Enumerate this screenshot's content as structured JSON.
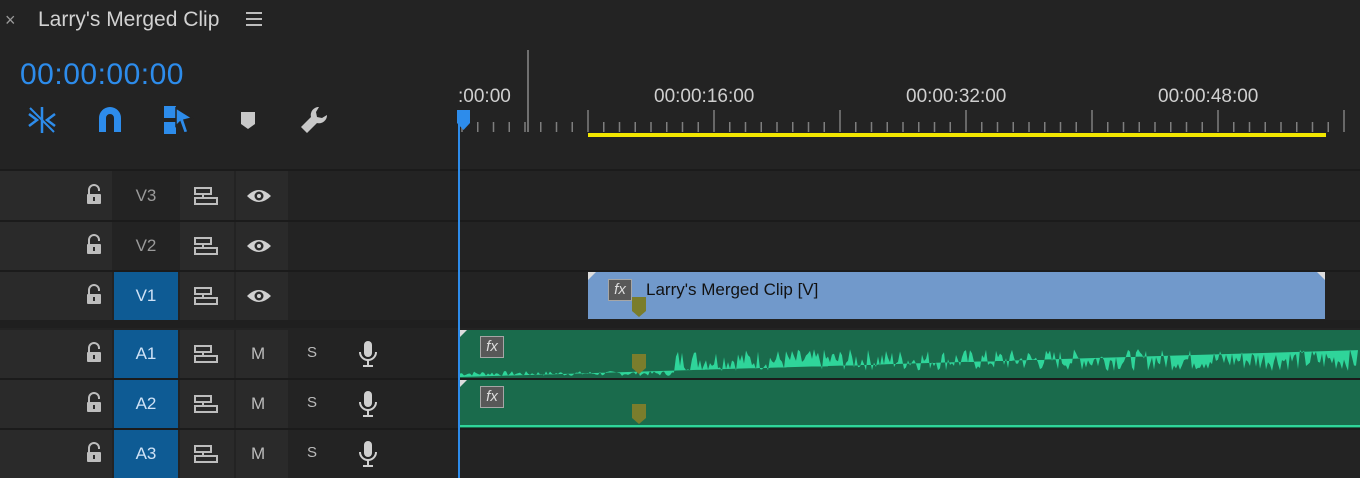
{
  "header": {
    "close_label": "×",
    "title": "Larry's Merged Clip",
    "menu_icon": "hamburger-menu-icon"
  },
  "timecode": "00:00:00:00",
  "toolbar": {
    "icons": [
      "insert-overwrite-sequences-icon",
      "snap-magnet-icon",
      "linked-selection-icon",
      "add-marker-icon",
      "timeline-settings-wrench-icon"
    ]
  },
  "ruler": {
    "labels": [
      ":00:00",
      "00:00:16:00",
      "00:00:32:00",
      "00:00:48:00"
    ]
  },
  "tracks": {
    "video": [
      {
        "name": "V3",
        "selected": false
      },
      {
        "name": "V2",
        "selected": false
      },
      {
        "name": "V1",
        "selected": true
      }
    ],
    "audio": [
      {
        "name": "A1",
        "selected": true,
        "mute": "M",
        "solo": "S"
      },
      {
        "name": "A2",
        "selected": true,
        "mute": "M",
        "solo": "S"
      },
      {
        "name": "A3",
        "selected": true,
        "mute": "M",
        "solo": "S"
      }
    ]
  },
  "clips": {
    "video_clip_label": "Larry's Merged Clip [V]",
    "fx_label": "fx"
  },
  "colors": {
    "accent": "#2d8ceb",
    "track_selected": "#0e5b94",
    "video_clip": "#7199cb",
    "audio_clip": "#1a6b4c",
    "waveform": "#2fd59a",
    "work_area": "#f2e600",
    "marker": "#7a7d2c"
  }
}
